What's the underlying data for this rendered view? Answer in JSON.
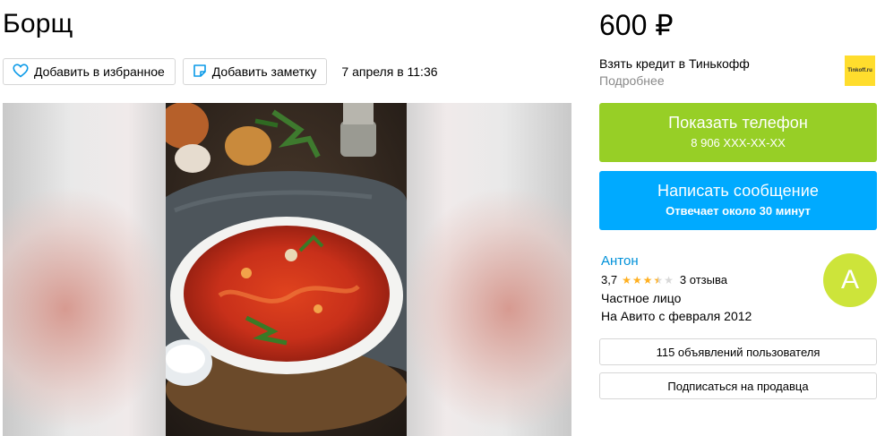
{
  "listing": {
    "title": "Борщ",
    "favorite_label": "Добавить в избранное",
    "note_label": "Добавить заметку",
    "date": "7 апреля в 11:36",
    "price": "600 ₽"
  },
  "credit": {
    "text": "Взять кредит в Тинькофф",
    "more": "Подробнее",
    "logo_text": "Tinkoff.ru"
  },
  "contact": {
    "phone_label": "Показать телефон",
    "phone_number": "8 906 XXX-XX-XX",
    "message_label": "Написать сообщение",
    "response_time": "Отвечает около 30 минут"
  },
  "seller": {
    "name": "Антон",
    "rating": "3,7",
    "rating_value": 3.7,
    "reviews": "3 отзыва",
    "type": "Частное лицо",
    "since": "На Авито с февраля 2012",
    "avatar_letter": "А",
    "ads_button": "115 объявлений пользователя",
    "subscribe_button": "Подписаться на продавца"
  },
  "colors": {
    "phone_button": "#97cf26",
    "message_button": "#00aaff",
    "seller_link": "#0091d9",
    "avatar": "#cde43a",
    "star_filled": "#ffb021",
    "star_empty": "#d8d8d8"
  },
  "icons": {
    "favorite": "heart-icon",
    "note": "note-icon"
  }
}
